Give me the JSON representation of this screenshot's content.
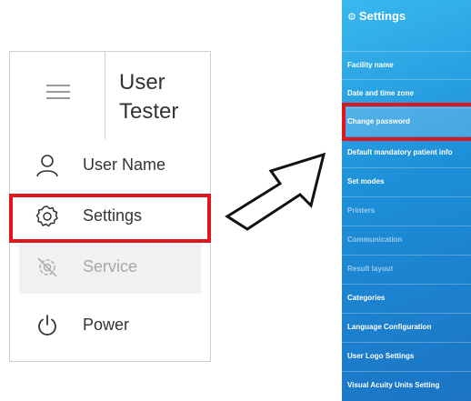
{
  "left_menu": {
    "header_title": "User Tester",
    "items": [
      {
        "label": "User Name",
        "icon": "user-icon"
      },
      {
        "label": "Settings",
        "icon": "gear-icon"
      },
      {
        "label": "Service",
        "icon": "service-icon"
      },
      {
        "label": "Power",
        "icon": "power-icon"
      }
    ]
  },
  "settings_panel": {
    "title": "Settings",
    "items": [
      {
        "label": "Facility name"
      },
      {
        "label": "Date and time zone"
      },
      {
        "label": "Change password"
      },
      {
        "label": "Default mandatory patient info"
      },
      {
        "label": "Set modes"
      },
      {
        "label": "Printers"
      },
      {
        "label": "Communication"
      },
      {
        "label": "Result layout"
      },
      {
        "label": "Categories"
      },
      {
        "label": "Language Configuration"
      },
      {
        "label": "User Logo Settings"
      },
      {
        "label": "Visual Acuity Units Setting"
      }
    ]
  },
  "colors": {
    "highlight_red": "#e0151e",
    "panel_blue": "#1d8fd8"
  }
}
